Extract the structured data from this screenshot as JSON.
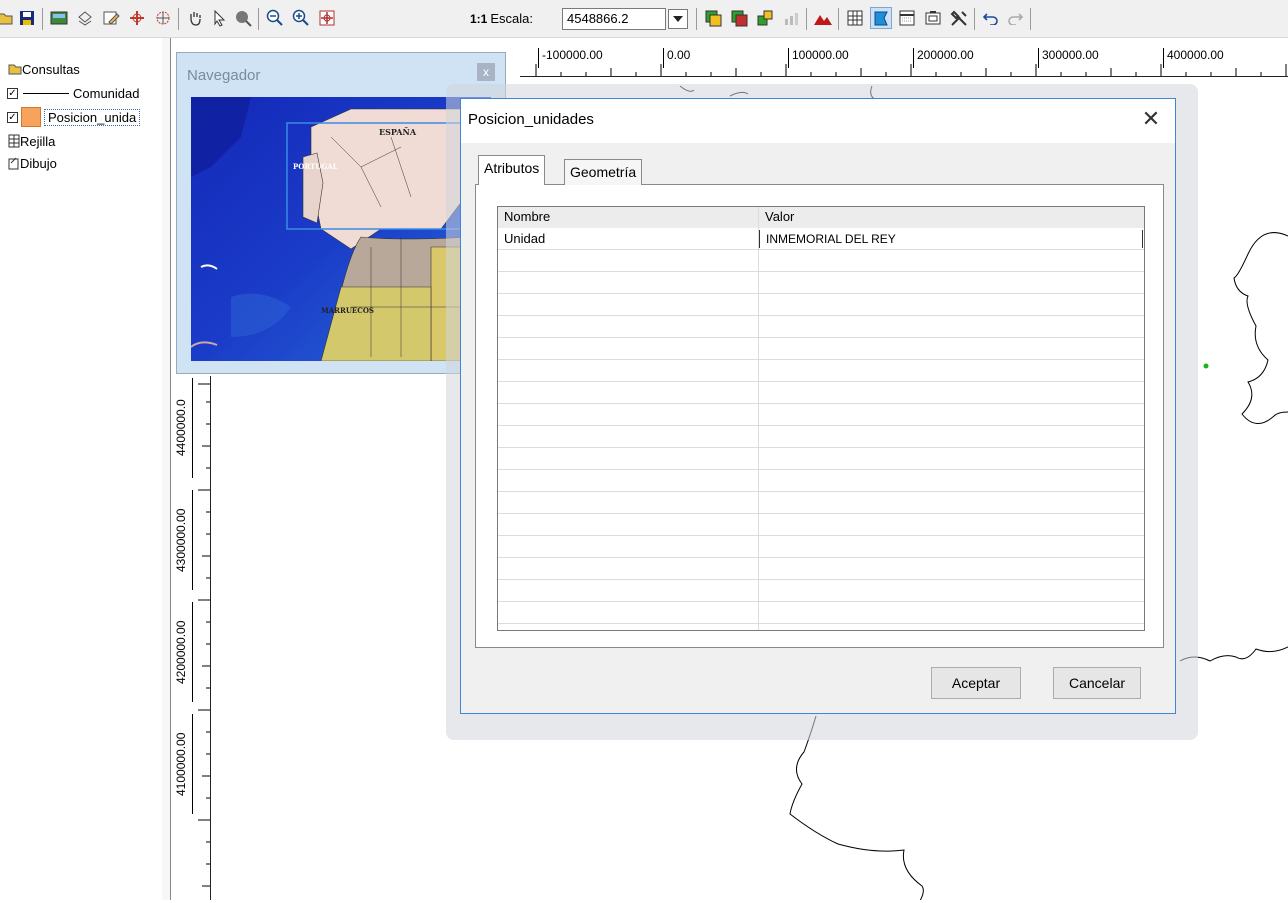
{
  "toolbar": {
    "scale_prefix": "1:1",
    "scale_label": "Escala:",
    "scale_value": "4548866.2"
  },
  "toc": {
    "items": [
      {
        "label": "Consultas"
      },
      {
        "label": "Comunidad",
        "checked": true
      },
      {
        "label": "Posicion_unida",
        "checked": true,
        "swatch": "#f7a35c"
      },
      {
        "label": "Rejilla"
      },
      {
        "label": "Dibujo"
      }
    ]
  },
  "ruler": {
    "horizontal": [
      "-100000.00",
      "0.00",
      "100000.00",
      "200000.00",
      "300000.00",
      "400000.00"
    ],
    "vertical": [
      "4400000.0",
      "4300000.00",
      "4200000.00",
      "4100000.00"
    ]
  },
  "navigator": {
    "title": "Navegador",
    "close": "x",
    "labels": [
      "ESPAÑA",
      "PORTUGAL",
      "MARRUECOS"
    ]
  },
  "dialog": {
    "title": "Posicion_unidades",
    "tabs": [
      {
        "label": "Atributos",
        "active": true
      },
      {
        "label": "Geometría",
        "active": false
      }
    ],
    "columns": [
      "Nombre",
      "Valor"
    ],
    "rows": [
      {
        "name": "Unidad",
        "value": "INMEMORIAL DEL REY"
      }
    ],
    "ok_label": "Aceptar",
    "cancel_label": "Cancelar"
  },
  "colors": {
    "dialog_border": "#3f86d6",
    "layer_swatch": "#f7a35c"
  }
}
